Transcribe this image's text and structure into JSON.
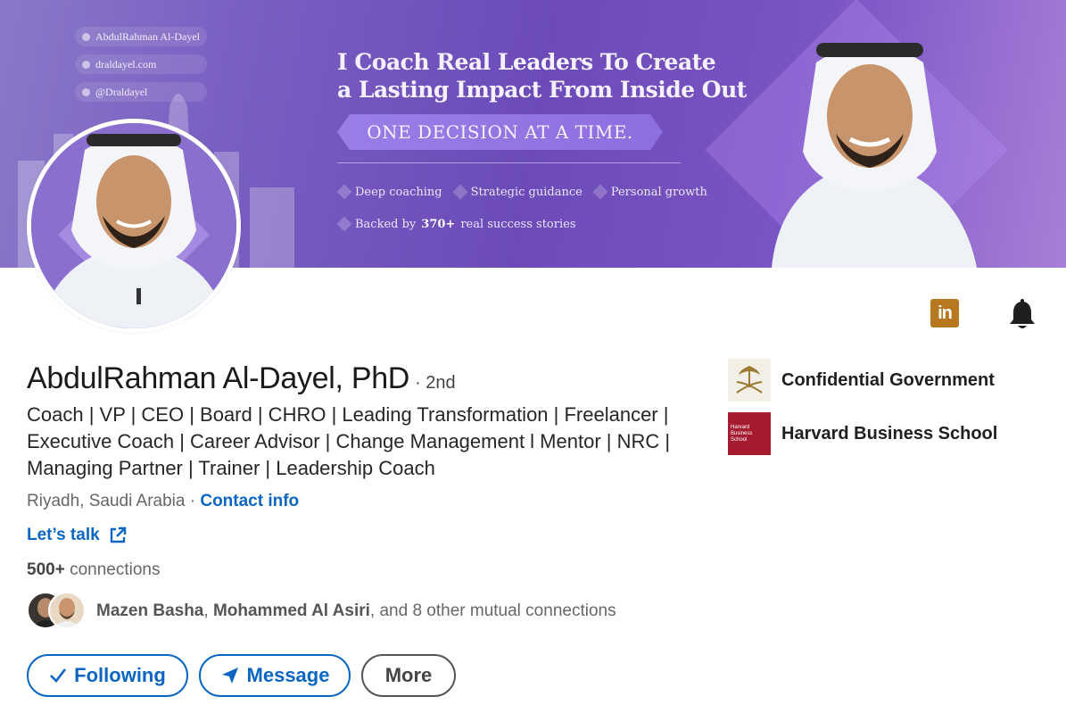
{
  "banner": {
    "social": {
      "name": "AbdulRahman Al-Dayel",
      "website": "draldayel.com",
      "handle": "@Draldayel"
    },
    "headline_line1": "I Coach Real Leaders To Create",
    "headline_line2": "a Lasting Impact From Inside Out",
    "pill": "ONE DECISION AT A TIME.",
    "tags": [
      "Deep coaching",
      "Strategic guidance",
      "Personal growth"
    ],
    "backed_prefix": "Backed by",
    "backed_number": "370+",
    "backed_suffix": "real success stories"
  },
  "profile": {
    "name": "AbdulRahman Al-Dayel, PhD",
    "degree": "· 2nd",
    "headline": "Coach | VP | CEO | Board | CHRO | Leading Transformation | Freelancer | Executive Coach | Career Advisor | Change Management l Mentor | NRC | Managing Partner | Trainer | Leadership Coach",
    "location": "Riyadh, Saudi Arabia",
    "separator": "·",
    "contact_info": "Contact info",
    "lets_talk": "Let’s talk",
    "connections_count": "500+",
    "connections_label": "connections",
    "mutual_name_1": "Mazen Basha",
    "mutual_name_2": "Mohammed Al Asiri",
    "mutual_rest": ", and 8 other mutual connections",
    "mutual_comma": ", "
  },
  "actions": {
    "following": "Following",
    "message": "Message",
    "more": "More"
  },
  "organizations": [
    {
      "name": "Confidential Government",
      "logo": "saudi-emblem-icon"
    },
    {
      "name": "Harvard Business School",
      "logo": "harvard-shield-icon",
      "logo_text": "Harvard Business School"
    }
  ],
  "icons": {
    "linkedin": "in",
    "linkedin_color": "#b7781f",
    "bell": "bell-icon"
  },
  "colors": {
    "link": "#0a66c2",
    "banner_purple": "#6c4bb8",
    "hbs_crimson": "#a51c30"
  }
}
